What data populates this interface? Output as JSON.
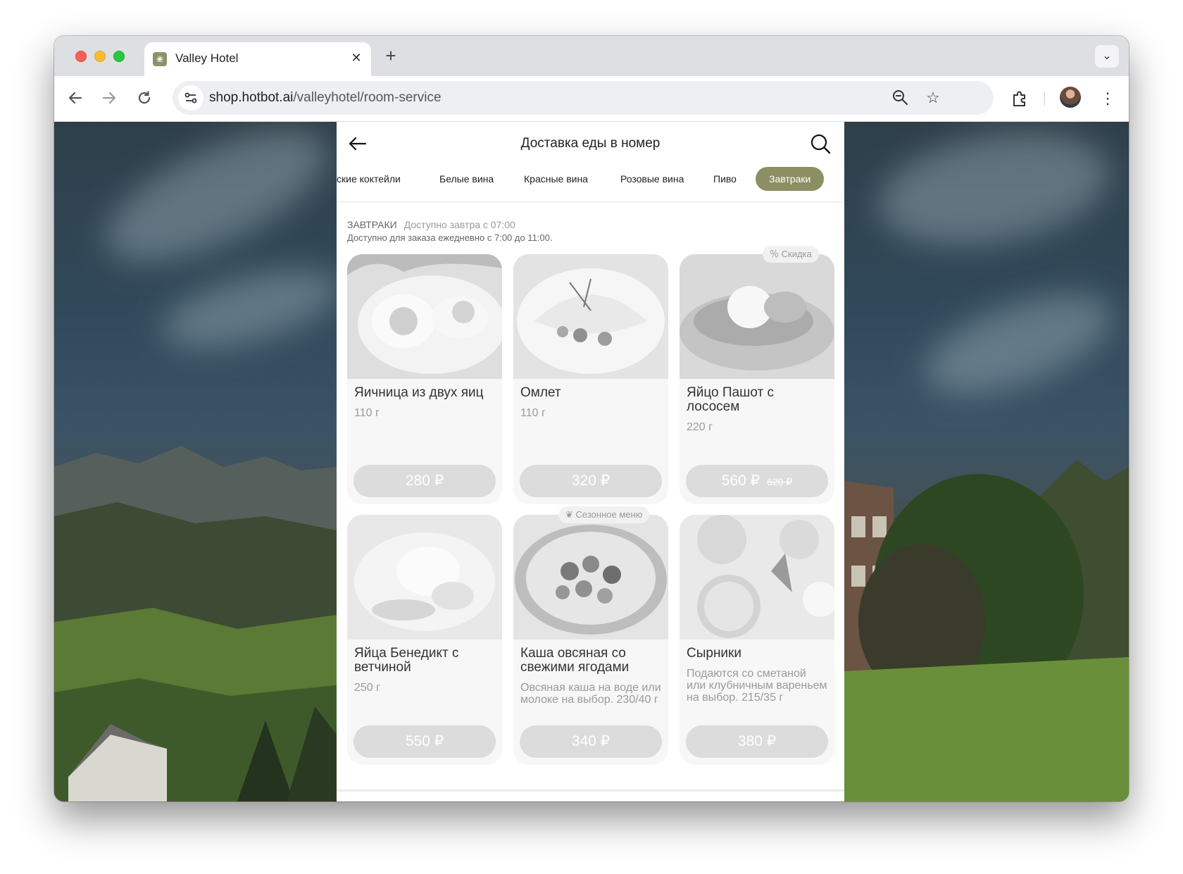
{
  "browser": {
    "tab_title": "Valley Hotel",
    "tab_close": "✕",
    "new_tab": "+",
    "url_host": "shop.hotbot.ai",
    "url_path": "/valleyhotel/room-service"
  },
  "page": {
    "title": "Доставка еды в номер",
    "categories": [
      "ские коктейли",
      "Белые вина",
      "Красные вина",
      "Розовые вина",
      "Пиво",
      "Завтраки"
    ],
    "active_category": "Завтраки",
    "section": {
      "title": "ЗАВТРАКИ",
      "availability": "Доступно завтра с 07:00",
      "note": "Доступно для заказа ежедневно с 7:00 до 11:00."
    },
    "items": [
      {
        "name": "Яичница из двух яиц",
        "desc": "110 г",
        "price": "280 ₽"
      },
      {
        "name": "Омлет",
        "desc": "110 г",
        "price": "320 ₽"
      },
      {
        "name": "Яйцо Пашот с лососем",
        "desc": "220 г",
        "price": "560 ₽",
        "old_price": "620 ₽",
        "badge": "Скидка"
      },
      {
        "name": "Яйца Бенедикт с ветчиной",
        "desc": "250 г",
        "price": "550 ₽"
      },
      {
        "name": "Каша овсяная со свежими ягодами",
        "desc": "Овсяная каша на воде или молоке на выбор. 230/40 г",
        "price": "340 ₽",
        "badge": "Сезонное меню"
      },
      {
        "name": "Сырники",
        "desc": "Подаются со сметаной или клубничным вареньем на выбор. 215/35 г",
        "price": "380 ₽"
      }
    ]
  },
  "colors": {
    "accent": "#8c8f63",
    "price_button": "#dcdcdc"
  }
}
